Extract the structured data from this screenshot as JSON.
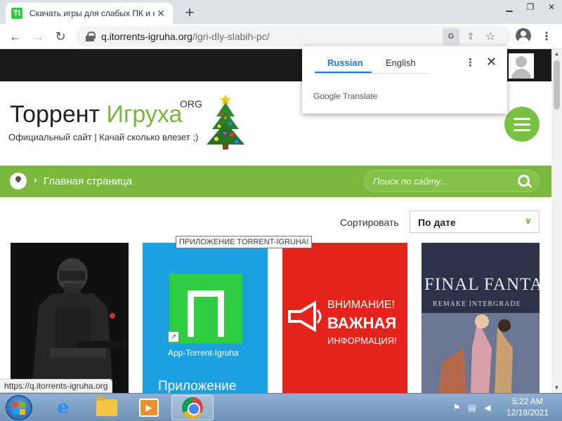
{
  "browser": {
    "tab_title": "Скачать игры для слабых ПК и н",
    "favicon_text": "TI",
    "url_host": "q.itorrents-igruha.org",
    "url_path": "/igri-dly-slabih-pc/",
    "status_url": "https://q.itorrents-igruha.org"
  },
  "translate_popup": {
    "tab_source": "Russian",
    "tab_target": "English",
    "brand": "Google Translate"
  },
  "site": {
    "logo_main": "Торрент ",
    "logo_accent": "Игруха",
    "logo_org": "ORG",
    "tagline": "Официальный сайт | Качай сколько влезет ;)",
    "breadcrumb": "Главная страница",
    "search_placeholder": "Поиск по сайту...",
    "sort_label": "Сортировать",
    "sort_value": "По дате",
    "accent_color": "#7ab83e"
  },
  "cards": {
    "app_tooltip": "ПРИЛОЖЕНИЕ TORRENT-IGRUHA!",
    "app_label": "App-Torrent-Igruha",
    "app_caption": "Приложение",
    "alert_line1": "ВНИМАНИЕ!",
    "alert_line2": "ВАЖНАЯ",
    "alert_line3": "ИНФОРМАЦИЯ!",
    "ff_title": "FINAL FANTASY.VI",
    "ff_subtitle": "REMAKE INTERGRADE"
  },
  "taskbar": {
    "time": "5:22 AM",
    "date": "12/18/2021"
  }
}
